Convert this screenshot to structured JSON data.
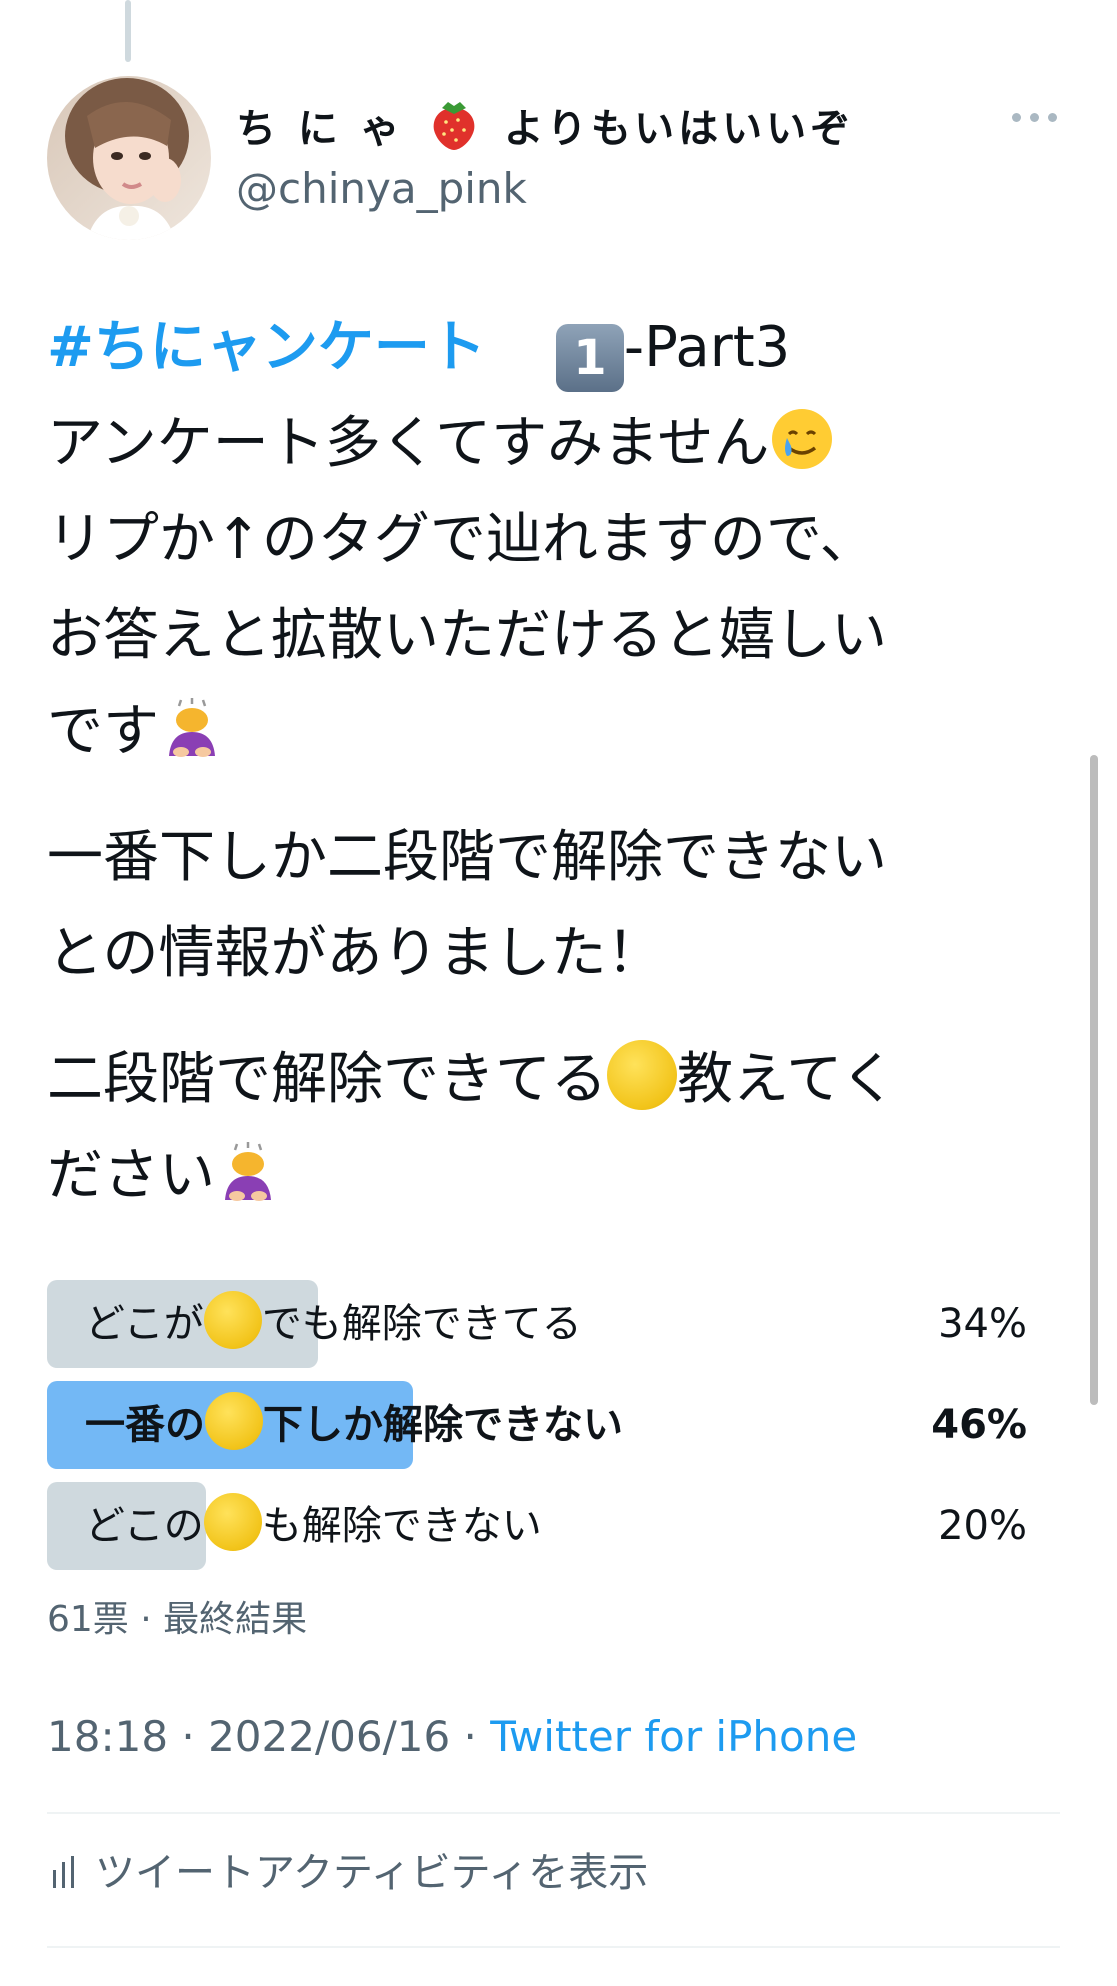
{
  "user": {
    "name_part1": "ち に ゃ",
    "name_part2": "よりもいはいいぞ",
    "name_emoji": "strawberry-emoji",
    "handle": "@chinya_pink"
  },
  "tweet": {
    "hashtag": "#ちにャンケート",
    "keycap": "1",
    "part": "-Part3",
    "line2": "アンケート多くてすみません",
    "line3": "リプか↑のタグで辿れますので、",
    "line4": "お答えと拡散いただけると嬉しい",
    "line5": "です",
    "para2_line1": "一番下しか二段階で解除できない",
    "para2_line2": "との情報がありました！",
    "para3_line1a": "二段階で解除できてる",
    "para3_line1b": "教えてく",
    "para3_line2": "ださい"
  },
  "poll": {
    "options": [
      {
        "label_before": "どこが",
        "label_after": "でも解除できてる",
        "percent": "34%",
        "value": 34,
        "winner": false
      },
      {
        "label_before": "一番の",
        "label_after": "下しか解除できない",
        "percent": "46%",
        "value": 46,
        "winner": true
      },
      {
        "label_before": "どこの",
        "label_after": "も解除できない",
        "percent": "20%",
        "value": 20,
        "winner": false
      }
    ],
    "meta": "61票 · 最終結果"
  },
  "footer": {
    "time": "18:18 · 2022/06/16 · ",
    "source": "Twitter for iPhone",
    "activity": "ツイートアクティビティを表示"
  },
  "colors": {
    "link": "#1d9bf0",
    "poll_winner": "#73b8f5",
    "poll_bar": "#cfd9de",
    "secondary_text": "#536471"
  }
}
